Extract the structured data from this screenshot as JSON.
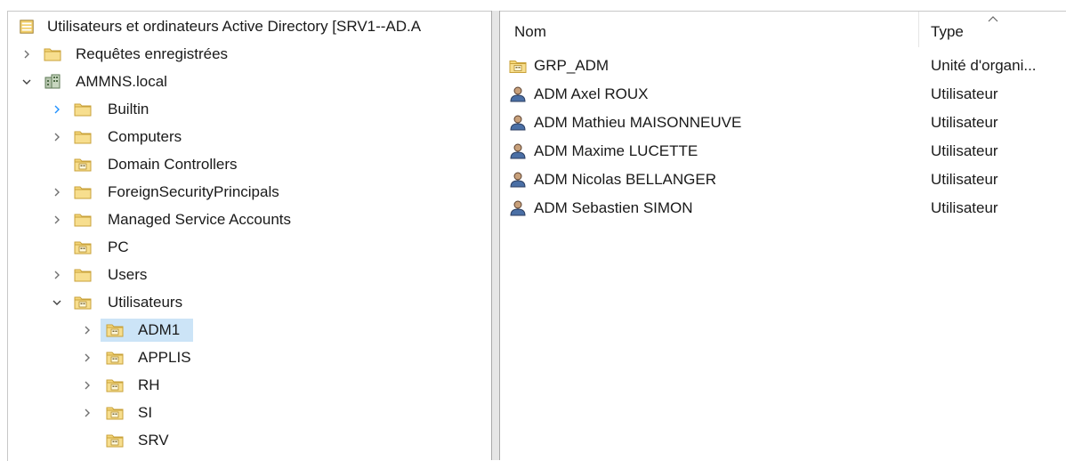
{
  "tree": {
    "root_title": "Utilisateurs et ordinateurs Active Directory [SRV1--AD.A",
    "saved_queries": "Requêtes enregistrées",
    "domain": "AMMNS.local",
    "items": [
      {
        "label": "Builtin"
      },
      {
        "label": "Computers"
      },
      {
        "label": "Domain Controllers"
      },
      {
        "label": "ForeignSecurityPrincipals"
      },
      {
        "label": "Managed Service Accounts"
      },
      {
        "label": "PC"
      },
      {
        "label": "Users"
      },
      {
        "label": "Utilisateurs"
      }
    ],
    "sub_items": [
      {
        "label": "ADM1"
      },
      {
        "label": "APPLIS"
      },
      {
        "label": "RH"
      },
      {
        "label": "SI"
      },
      {
        "label": "SRV"
      }
    ]
  },
  "list": {
    "columns": {
      "name": "Nom",
      "type": "Type"
    },
    "rows": [
      {
        "name": "GRP_ADM",
        "type": "Unité d'organi...",
        "icon": "ou-folder-icon"
      },
      {
        "name": "ADM Axel ROUX",
        "type": "Utilisateur",
        "icon": "user-icon"
      },
      {
        "name": "ADM Mathieu MAISONNEUVE",
        "type": "Utilisateur",
        "icon": "user-icon"
      },
      {
        "name": "ADM Maxime LUCETTE",
        "type": "Utilisateur",
        "icon": "user-icon"
      },
      {
        "name": "ADM Nicolas BELLANGER",
        "type": "Utilisateur",
        "icon": "user-icon"
      },
      {
        "name": "ADM Sebastien SIMON",
        "type": "Utilisateur",
        "icon": "user-icon"
      }
    ]
  },
  "colors": {
    "selection": "#cce4f7",
    "folder": "#f2cf6b",
    "accent": "#1e90ff"
  }
}
